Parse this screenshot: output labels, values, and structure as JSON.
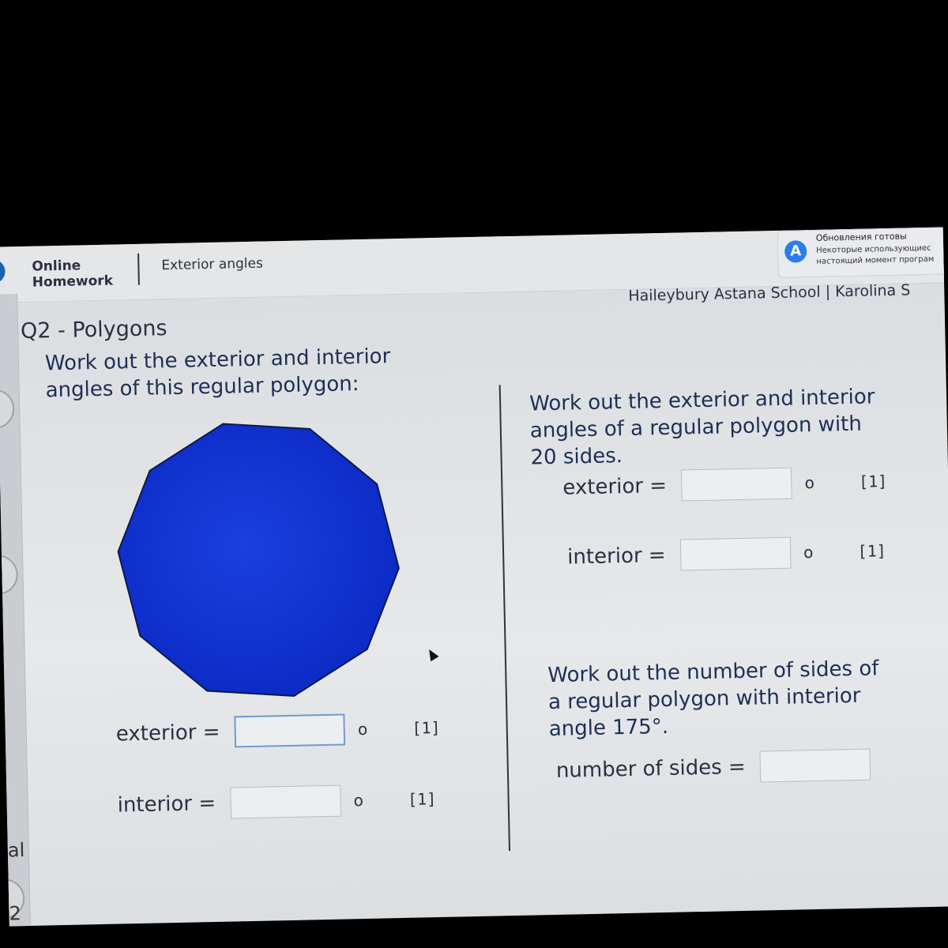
{
  "header": {
    "brand_line1": "Online",
    "brand_line2": "Homework",
    "section": "Exterior angles"
  },
  "notification": {
    "icon": "app-store-icon",
    "title": "Обновления готовы",
    "line1": "Некоторые использующиес",
    "line2": "настоящий момент програм"
  },
  "school": "Haileybury Astana School | Karolina S",
  "question": {
    "title": "Q2 - Polygons",
    "left_prompt_1": "Work out the exterior and interior",
    "left_prompt_2": "angles of this regular polygon:",
    "polygon": {
      "sides": 10,
      "fill": "#0a2fd0",
      "stroke": "#0b1a4a"
    },
    "left_answers": [
      {
        "label": "exterior =",
        "degree": "o",
        "marks": "[1]"
      },
      {
        "label": "interior =",
        "degree": "o",
        "marks": "[1]"
      }
    ],
    "right_prompt_a_1": "Work out the exterior and interior",
    "right_prompt_a_2": "angles of a regular polygon with",
    "right_prompt_a_3": "20 sides.",
    "right_answers": [
      {
        "label": "exterior =",
        "degree": "o",
        "marks": "[1]"
      },
      {
        "label": "interior =",
        "degree": "o",
        "marks": "[1]"
      }
    ],
    "right_prompt_b_1": "Work out the number of sides of",
    "right_prompt_b_2": "a regular polygon with interior",
    "right_prompt_b_3": "angle 175°.",
    "sides_label": "number of sides ="
  },
  "strip": {
    "text1": "al",
    "text2": "2"
  }
}
